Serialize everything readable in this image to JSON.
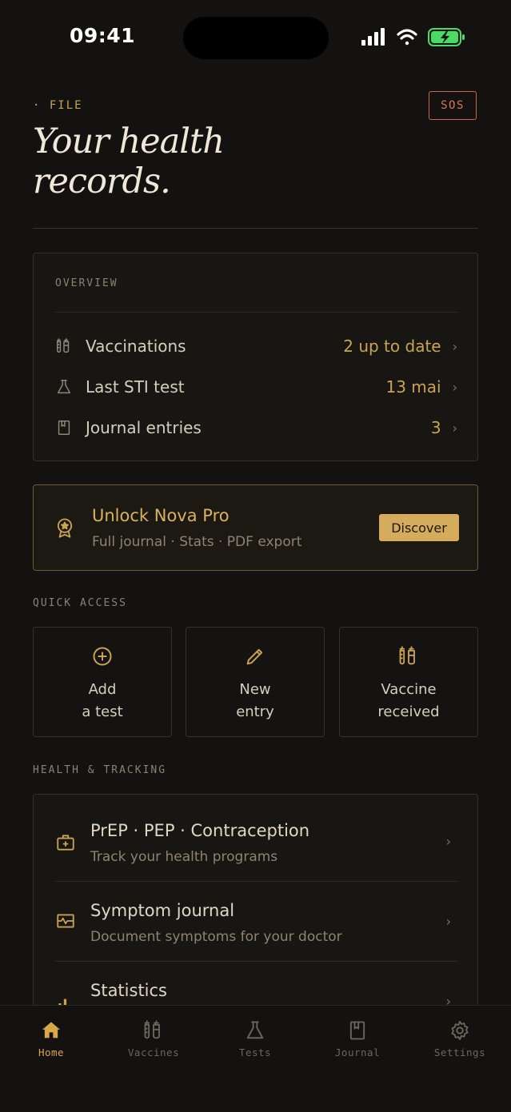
{
  "status_bar": {
    "time": "09:41"
  },
  "header": {
    "eyebrow": "· FILE",
    "sos_label": "SOS",
    "title": "Your health records."
  },
  "overview": {
    "label": "OVERVIEW",
    "rows": [
      {
        "icon": "syringe-icon",
        "label": "Vaccinations",
        "value": "2 up to date"
      },
      {
        "icon": "flask-icon",
        "label": "Last STI test",
        "value": "13 mai"
      },
      {
        "icon": "bookmark-book-icon",
        "label": "Journal entries",
        "value": "3"
      }
    ]
  },
  "pro_banner": {
    "title": "Unlock Nova Pro",
    "subtitle": "Full journal · Stats · PDF export",
    "button": "Discover"
  },
  "quick_access": {
    "label": "QUICK ACCESS",
    "tiles": [
      {
        "icon": "plus-circle-icon",
        "label": "Add\na test"
      },
      {
        "icon": "pencil-icon",
        "label": "New\nentry"
      },
      {
        "icon": "syringe-icon",
        "label": "Vaccine\nreceived"
      }
    ]
  },
  "health_tracking": {
    "label": "HEALTH & TRACKING",
    "items": [
      {
        "icon": "medkit-icon",
        "title": "PrEP · PEP · Contraception",
        "subtitle": "Track your health programs"
      },
      {
        "icon": "pulse-icon",
        "title": "Symptom journal",
        "subtitle": "Document symptoms for your doctor"
      },
      {
        "icon": "bar-chart-icon",
        "title": "Statistics",
        "subtitle": ""
      }
    ]
  },
  "tab_bar": {
    "tabs": [
      {
        "icon": "home-icon",
        "label": "Home",
        "active": true
      },
      {
        "icon": "syringe-icon",
        "label": "Vaccines",
        "active": false
      },
      {
        "icon": "flask-icon",
        "label": "Tests",
        "active": false
      },
      {
        "icon": "book-icon",
        "label": "Journal",
        "active": false
      },
      {
        "icon": "gear-icon",
        "label": "Settings",
        "active": false
      }
    ]
  },
  "colors": {
    "background": "#141210",
    "accent": "#c9a254",
    "sos": "#d4774f",
    "active_tab": "#d9a748"
  }
}
